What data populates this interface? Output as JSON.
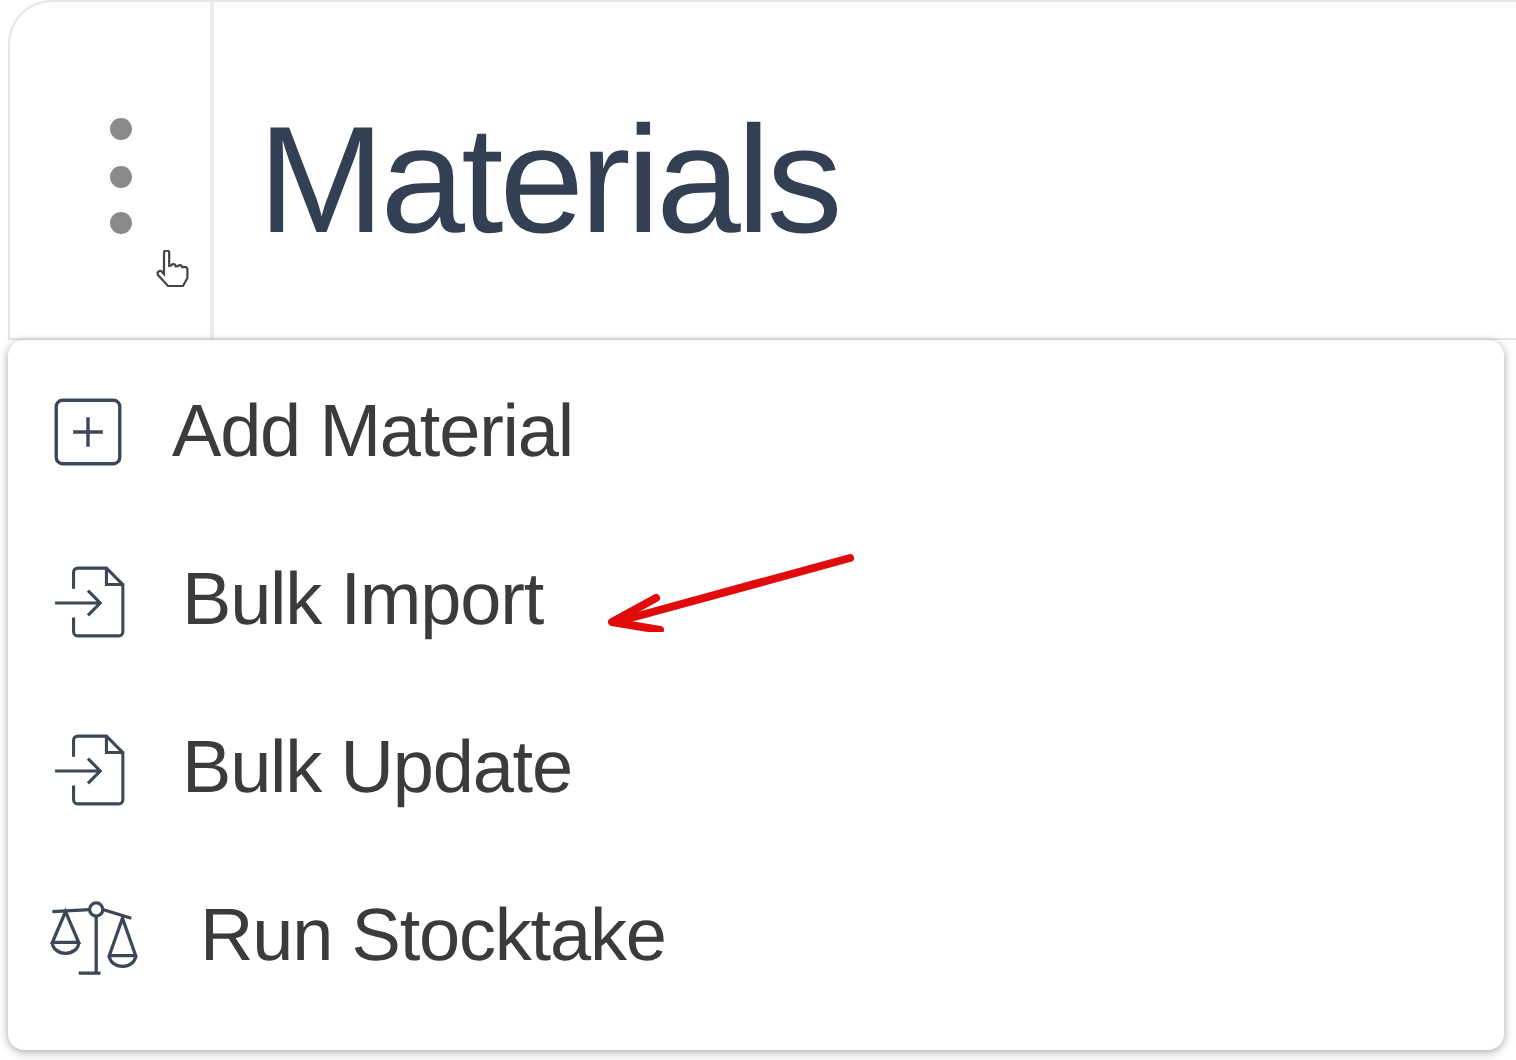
{
  "header": {
    "title": "Materials"
  },
  "menu": {
    "items": [
      {
        "label": "Add Material",
        "kind": "add"
      },
      {
        "label": "Bulk Import",
        "kind": "import"
      },
      {
        "label": "Bulk Update",
        "kind": "import"
      },
      {
        "label": "Run Stocktake",
        "kind": "scale"
      }
    ]
  }
}
